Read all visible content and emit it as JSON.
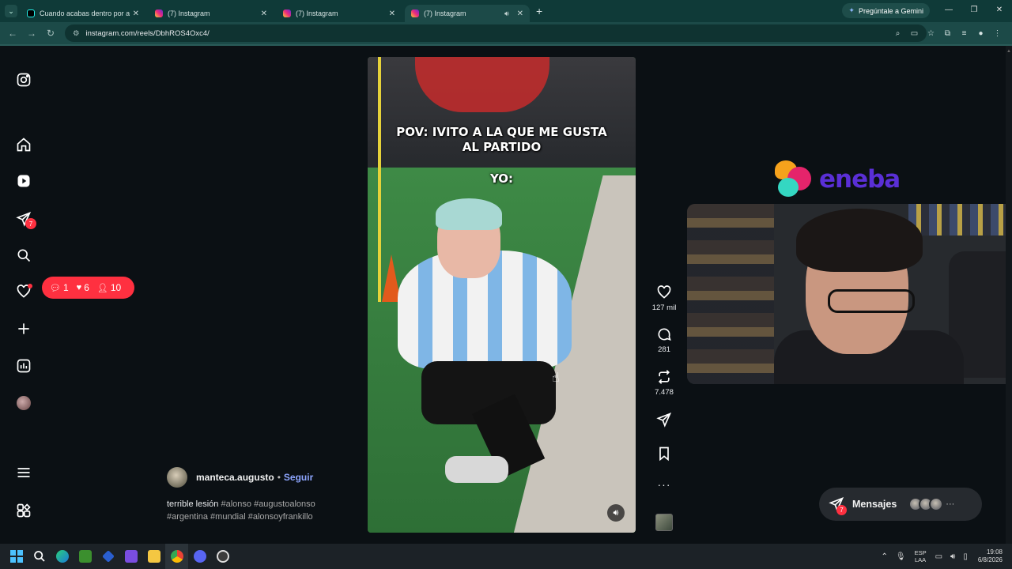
{
  "browser": {
    "tabs": [
      {
        "title": "Cuando acabas dentro por acci",
        "icon": "tiktok-icon",
        "active": false
      },
      {
        "title": "(7) Instagram",
        "icon": "instagram-icon",
        "active": false
      },
      {
        "title": "(7) Instagram",
        "icon": "instagram-icon",
        "active": false
      },
      {
        "title": "(7) Instagram",
        "icon": "instagram-icon",
        "active": true
      }
    ],
    "gemini_label": "Pregúntale a Gemini",
    "url": "instagram.com/reels/DbhROS4Oxc4/"
  },
  "sidebar": {
    "messages_badge": "7"
  },
  "notifications": {
    "comments": "1",
    "likes": "6",
    "follows": "10"
  },
  "reel": {
    "caption_line1": "POV: IVITO A LA QUE ME GUSTA",
    "caption_line2": "AL PARTIDO",
    "caption_yo": "YO:",
    "likes": "127 mil",
    "comments": "281",
    "reposts": "7.478",
    "author": "manteca.augusto",
    "follow_label": "Seguir",
    "description_text": "terrible lesión",
    "description_tags_1": "#alonso #augustoalonso",
    "description_tags_2": "#argentina #mundial #alonsoyfrankillo"
  },
  "overlay": {
    "sponsor": "eneba"
  },
  "messages_pill": {
    "label": "Mensajes",
    "badge": "7"
  },
  "taskbar": {
    "lang_line1": "ESP",
    "lang_line2": "LAA",
    "time": "19:08",
    "date": "6/8/2026"
  }
}
